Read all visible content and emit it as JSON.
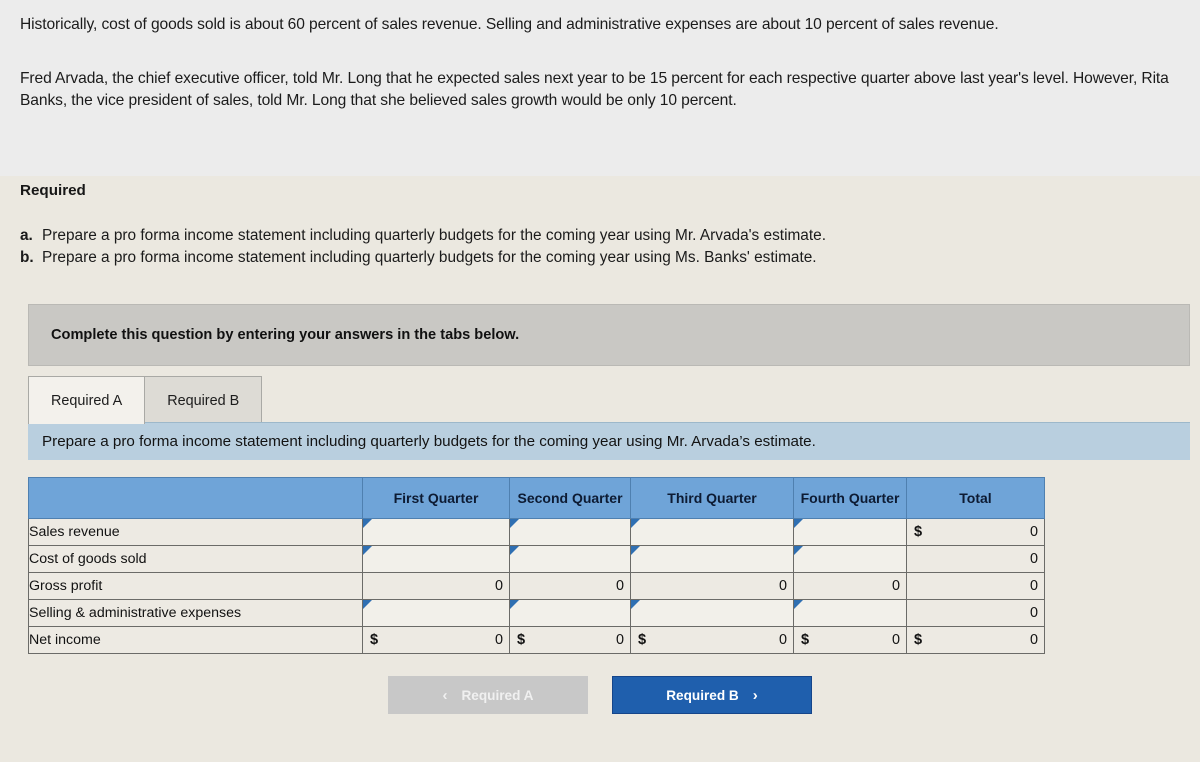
{
  "problem": {
    "paragraph_1": "Historically, cost of goods sold is about 60 percent of sales revenue. Selling and administrative expenses are about 10 percent of sales revenue.",
    "paragraph_2": "Fred Arvada, the chief executive officer, told Mr. Long that he expected sales next year to be 15 percent for each respective quarter above last year's level. However, Rita Banks, the vice president of sales, told Mr. Long that she believed sales growth would be only 10 percent."
  },
  "required": {
    "heading": "Required",
    "items": [
      {
        "marker": "a.",
        "text": "Prepare a pro forma income statement including quarterly budgets for the coming year using Mr. Arvada's estimate."
      },
      {
        "marker": "b.",
        "text": "Prepare a pro forma income statement including quarterly budgets for the coming year using Ms. Banks' estimate."
      }
    ]
  },
  "banner": {
    "text": "Complete this question by entering your answers in the tabs below."
  },
  "tabs": [
    {
      "label": "Required A",
      "active": true
    },
    {
      "label": "Required B",
      "active": false
    }
  ],
  "instruction": {
    "text": "Prepare a pro forma income statement including quarterly budgets for the coming year using Mr. Arvada’s estimate."
  },
  "table": {
    "columns": [
      "",
      "First Quarter",
      "Second Quarter",
      "Third Quarter",
      "Fourth Quarter",
      "Total"
    ],
    "rows": [
      {
        "label": "Sales revenue",
        "cells": [
          {
            "type": "input",
            "symbol": "",
            "value": ""
          },
          {
            "type": "input",
            "symbol": "",
            "value": ""
          },
          {
            "type": "input",
            "symbol": "",
            "value": ""
          },
          {
            "type": "input",
            "symbol": "",
            "value": ""
          },
          {
            "type": "computed",
            "symbol": "$",
            "value": "0"
          }
        ]
      },
      {
        "label": "Cost of goods sold",
        "cells": [
          {
            "type": "input",
            "symbol": "",
            "value": ""
          },
          {
            "type": "input",
            "symbol": "",
            "value": ""
          },
          {
            "type": "input",
            "symbol": "",
            "value": ""
          },
          {
            "type": "input",
            "symbol": "",
            "value": ""
          },
          {
            "type": "computed",
            "symbol": "",
            "value": "0"
          }
        ]
      },
      {
        "label": "Gross profit",
        "cells": [
          {
            "type": "computed",
            "symbol": "",
            "value": "0"
          },
          {
            "type": "computed",
            "symbol": "",
            "value": "0"
          },
          {
            "type": "computed",
            "symbol": "",
            "value": "0"
          },
          {
            "type": "computed",
            "symbol": "",
            "value": "0"
          },
          {
            "type": "computed",
            "symbol": "",
            "value": "0"
          }
        ]
      },
      {
        "label": "Selling & administrative expenses",
        "cells": [
          {
            "type": "input",
            "symbol": "",
            "value": ""
          },
          {
            "type": "input",
            "symbol": "",
            "value": ""
          },
          {
            "type": "input",
            "symbol": "",
            "value": ""
          },
          {
            "type": "input",
            "symbol": "",
            "value": ""
          },
          {
            "type": "computed",
            "symbol": "",
            "value": "0"
          }
        ]
      },
      {
        "label": "Net income",
        "cells": [
          {
            "type": "computed",
            "symbol": "$",
            "value": "0"
          },
          {
            "type": "computed",
            "symbol": "$",
            "value": "0"
          },
          {
            "type": "computed",
            "symbol": "$",
            "value": "0"
          },
          {
            "type": "computed",
            "symbol": "$",
            "value": "0"
          },
          {
            "type": "computed",
            "symbol": "$",
            "value": "0"
          }
        ]
      }
    ]
  },
  "nav": {
    "prev": {
      "label": "Required A",
      "chevron": "‹",
      "enabled": false
    },
    "next": {
      "label": "Required B",
      "chevron": "›",
      "enabled": true
    }
  },
  "colors": {
    "header_blue": "#6fa4d8",
    "instruction_blue": "#b9cfdf",
    "banner_grey": "#c9c8c4",
    "primary_button": "#1f5fad",
    "disabled_button": "#c8c8c8",
    "page_background": "#ebe8e0",
    "top_background": "#ececec",
    "marker_blue": "#2f6fb2"
  }
}
